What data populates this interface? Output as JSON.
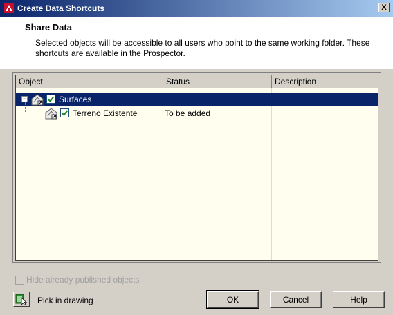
{
  "window": {
    "title": "Create Data Shortcuts",
    "close_label": "X"
  },
  "header": {
    "title": "Share Data",
    "description": "Selected objects will be accessible to all users who point to the same working folder. These shortcuts are available in the Prospector."
  },
  "table": {
    "columns": [
      "Object",
      "Status",
      "Description"
    ],
    "rows": [
      {
        "expander": "−",
        "checked": true,
        "object": "Surfaces",
        "status": "",
        "description": "",
        "selected": true
      },
      {
        "checked": true,
        "object": "Terreno Existente",
        "status": "To be added",
        "description": "",
        "selected": false
      }
    ]
  },
  "options": {
    "hide_published_label": "Hide already published objects",
    "hide_published_checked": false,
    "hide_published_enabled": false
  },
  "footer": {
    "pick_label": "Pick in drawing",
    "ok_label": "OK",
    "cancel_label": "Cancel",
    "help_label": "Help"
  },
  "colors": {
    "selection": "#0a246a",
    "grid_background": "#fffeef",
    "check": "#1a8a1a"
  }
}
